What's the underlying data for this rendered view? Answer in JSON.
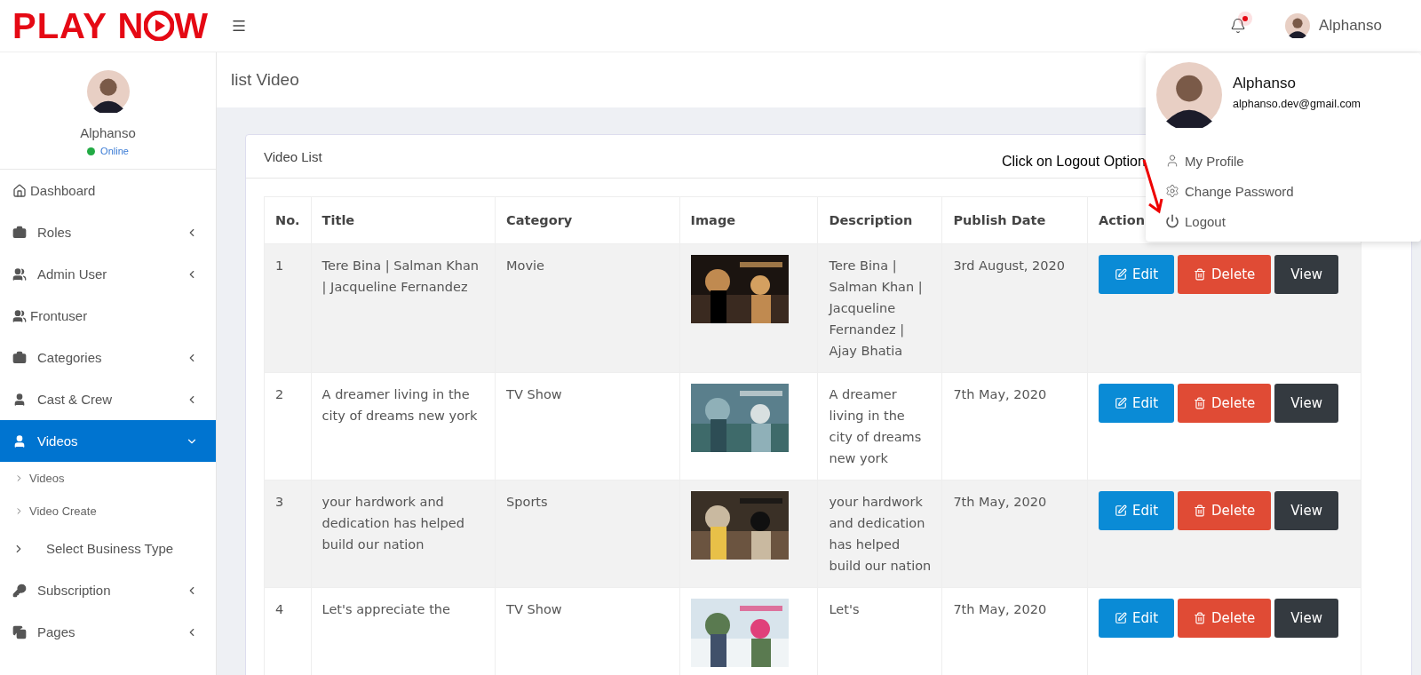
{
  "header": {
    "logo": {
      "left": "PLAY N",
      "right": "W"
    },
    "notification": {
      "unread": true
    },
    "user_name": "Alphanso"
  },
  "sidebar": {
    "user": {
      "name": "Alphanso",
      "status": "Online",
      "online": true
    },
    "items": [
      {
        "label": "Dashboard",
        "kind": "plain",
        "selected": false
      },
      {
        "label": "Roles",
        "kind": "submenu",
        "selected": false,
        "expanded": false
      },
      {
        "label": "Admin User",
        "kind": "submenu",
        "selected": false,
        "expanded": false
      },
      {
        "label": "Frontuser",
        "kind": "plain",
        "selected": false
      },
      {
        "label": "Categories",
        "kind": "submenu",
        "selected": false,
        "expanded": false
      },
      {
        "label": "Cast & Crew",
        "kind": "submenu",
        "selected": false,
        "expanded": false
      },
      {
        "label": "Videos",
        "kind": "submenu",
        "selected": true,
        "expanded": true,
        "children": [
          {
            "label": "Videos"
          },
          {
            "label": "Video Create"
          }
        ]
      },
      {
        "label": "Select Business Type",
        "kind": "arrow-link",
        "selected": false
      },
      {
        "label": "Subscription",
        "kind": "submenu",
        "selected": false,
        "expanded": false
      },
      {
        "label": "Pages",
        "kind": "submenu",
        "selected": false,
        "expanded": false
      }
    ]
  },
  "page_title": "list Video",
  "card": {
    "title": "Video List",
    "table": {
      "columns": [
        "No.",
        "Title",
        "Category",
        "Image",
        "Description",
        "Publish Date",
        "Action"
      ],
      "rows": [
        {
          "no": "1",
          "title": "Tere Bina | Salman Khan | Jacqueline Fernandez",
          "category": "Movie",
          "image": {
            "kind": "picture"
          },
          "description": "Tere Bina | Salman Khan | Jacqueline Fernandez | Ajay Bhatia",
          "publish_date": "3rd August, 2020",
          "actions": [
            {
              "label": "Edit",
              "kind": "edit"
            },
            {
              "label": "Delete",
              "kind": "delete"
            },
            {
              "label": "View",
              "kind": "view"
            }
          ]
        },
        {
          "no": "2",
          "title": "A dreamer living in the city of dreams new york",
          "category": "TV Show",
          "image": {
            "kind": "picture"
          },
          "description": "A dreamer living in the city of dreams new york",
          "publish_date": "7th May, 2020",
          "actions": [
            {
              "label": "Edit",
              "kind": "edit"
            },
            {
              "label": "Delete",
              "kind": "delete"
            },
            {
              "label": "View",
              "kind": "view"
            }
          ]
        },
        {
          "no": "3",
          "title": "your hardwork and dedication has helped build our nation",
          "category": "Sports",
          "image": {
            "kind": "picture"
          },
          "description": "your hardwork and dedication has helped build our nation",
          "publish_date": "7th May, 2020",
          "actions": [
            {
              "label": "Edit",
              "kind": "edit"
            },
            {
              "label": "Delete",
              "kind": "delete"
            },
            {
              "label": "View",
              "kind": "view"
            }
          ]
        },
        {
          "no": "4",
          "title": "Let's appreciate the",
          "category": "TV Show",
          "image": {
            "kind": "picture"
          },
          "description": "Let's",
          "publish_date": "7th May, 2020",
          "actions": [
            {
              "label": "Edit",
              "kind": "edit"
            },
            {
              "label": "Delete",
              "kind": "delete"
            },
            {
              "label": "View",
              "kind": "view"
            }
          ]
        }
      ]
    }
  },
  "user_menu": {
    "name": "Alphanso",
    "email": "alphanso.dev@gmail.com",
    "items": [
      {
        "label": "My Profile"
      },
      {
        "label": "Change Password"
      },
      {
        "label": "Logout"
      }
    ]
  },
  "annotation": {
    "text": "Click on Logout Option"
  }
}
